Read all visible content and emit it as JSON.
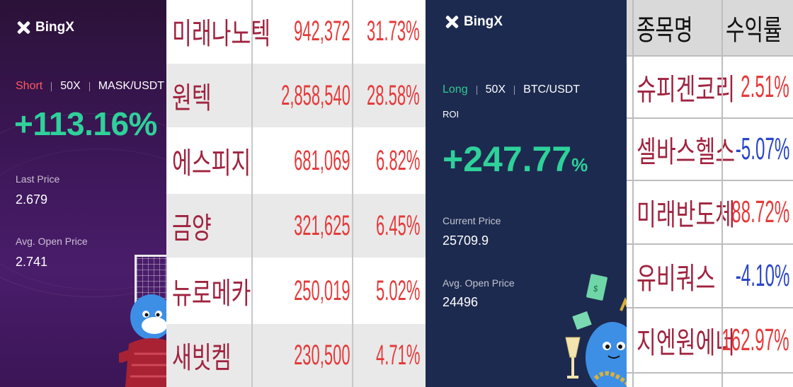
{
  "card_short": {
    "brand": "BingX",
    "side": "Short",
    "leverage": "50X",
    "pair": "MASK/USDT",
    "pnl": "+113.16%",
    "last_price_label": "Last Price",
    "last_price": "2.679",
    "avg_open_label": "Avg. Open Price",
    "avg_open": "2.741",
    "colors": {
      "background": "#3a1654",
      "short": "#ff5a5f",
      "pnl": "#2ed19a"
    }
  },
  "table_left": {
    "rows": [
      {
        "name": "미래나노텍",
        "price": "942,372",
        "rate": "31.73%"
      },
      {
        "name": "원텍",
        "price": "2,858,540",
        "rate": "28.58%"
      },
      {
        "name": "에스피지",
        "price": "681,069",
        "rate": "6.82%"
      },
      {
        "name": "금양",
        "price": "321,625",
        "rate": "6.45%"
      },
      {
        "name": "뉴로메카",
        "price": "250,019",
        "rate": "5.02%"
      },
      {
        "name": "새빗켐",
        "price": "230,500",
        "rate": "4.71%"
      }
    ],
    "colors": {
      "name": "#a0233f",
      "value": "#e53a3a",
      "stripe": "#e9e9e9"
    }
  },
  "card_long": {
    "brand": "BingX",
    "side": "Long",
    "leverage": "50X",
    "pair": "BTC/USDT",
    "roi_label": "ROI",
    "pnl": "+247.77",
    "pnl_unit": "%",
    "current_price_label": "Current Price",
    "current_price": "25709.9",
    "avg_open_label": "Avg. Open Price",
    "avg_open": "24496",
    "colors": {
      "background": "#1d2a4f",
      "long": "#2ecc8f",
      "pnl": "#2ed19a"
    }
  },
  "table_right": {
    "headers": {
      "name": "종목명",
      "rate": "수익률"
    },
    "rows": [
      {
        "name": "슈피겐코리",
        "rate": "2.51%",
        "tone": "red"
      },
      {
        "name": "셀바스헬스",
        "rate": "-5.07%",
        "tone": "blue"
      },
      {
        "name": "미래반도체",
        "rate": "88.72%",
        "tone": "red"
      },
      {
        "name": "유비쿼스",
        "rate": "-4.10%",
        "tone": "blue"
      },
      {
        "name": "지엔원에너",
        "rate": "162.97%",
        "tone": "red"
      }
    ],
    "colors": {
      "header_bg": "#d9d9d9",
      "name": "#a0233f",
      "positive": "#e53a3a",
      "negative": "#2a45c8"
    }
  }
}
